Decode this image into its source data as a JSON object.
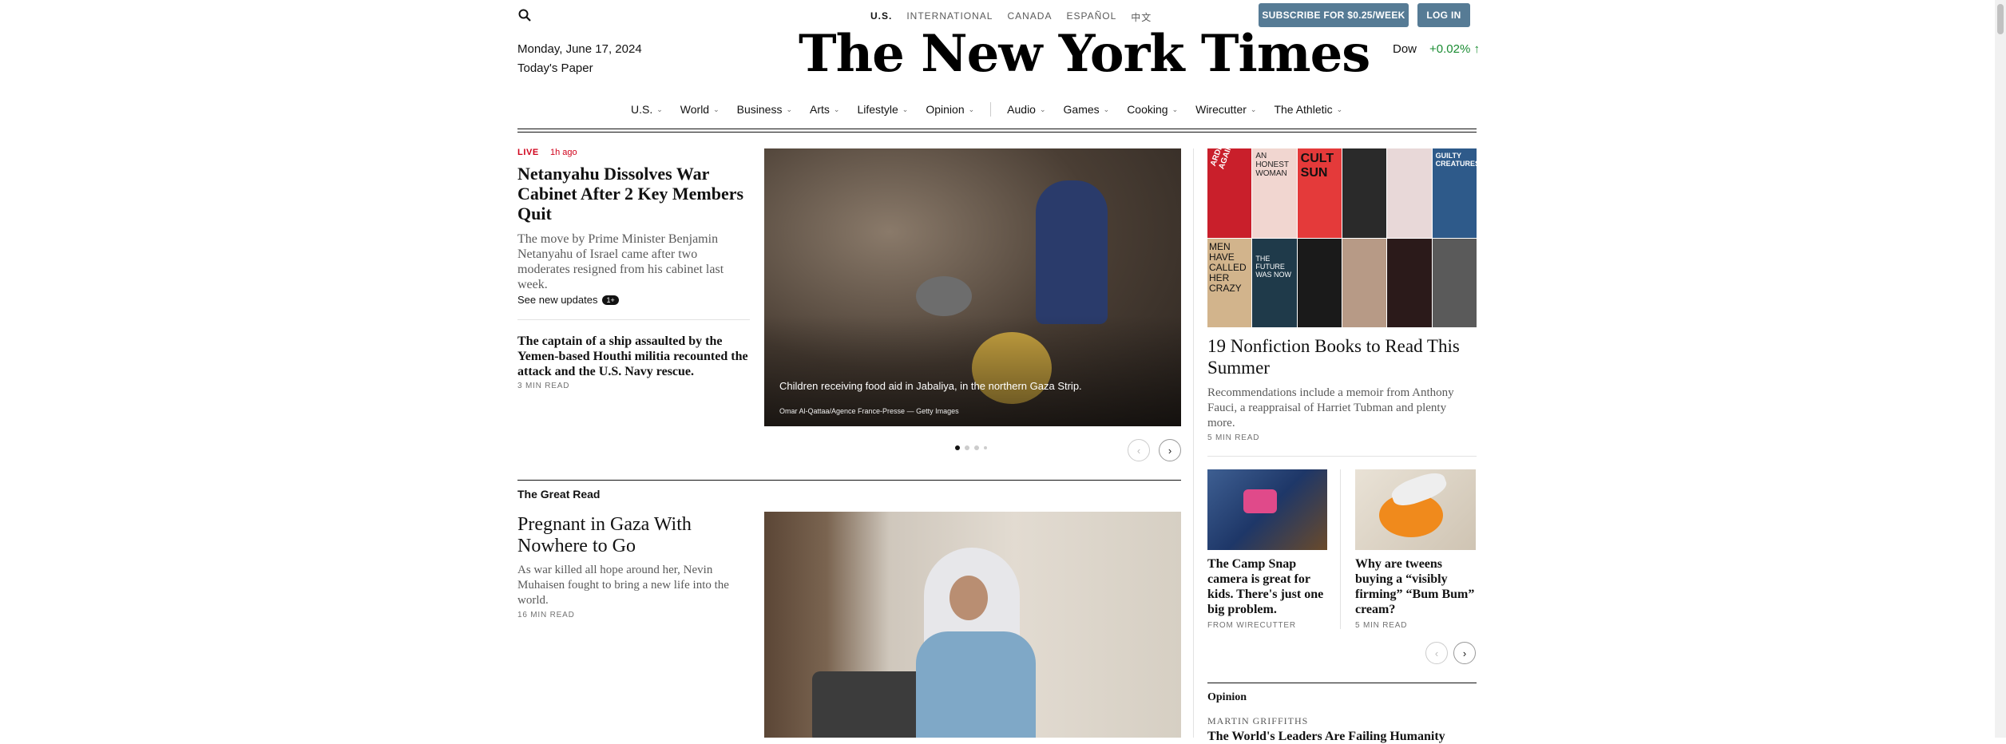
{
  "header": {
    "editions": [
      "U.S.",
      "INTERNATIONAL",
      "CANADA",
      "ESPAÑOL",
      "中文"
    ],
    "subscribe_label": "SUBSCRIBE FOR $0.25/WEEK",
    "login_label": "LOG IN",
    "date": "Monday, June 17, 2024",
    "todays_paper": "Today's Paper",
    "masthead": "The New York Times",
    "market_label": "Dow",
    "market_value": "+0.02% ↑",
    "search_icon": "search-icon"
  },
  "nav": {
    "items": [
      "U.S.",
      "World",
      "Business",
      "Arts",
      "Lifestyle",
      "Opinion",
      "Audio",
      "Games",
      "Cooking",
      "Wirecutter",
      "The Athletic"
    ]
  },
  "lead": {
    "live": "LIVE",
    "ago": "1h ago",
    "headline": "Netanyahu Dissolves War Cabinet After 2 Key Members Quit",
    "summary": "The move by Prime Minister Benjamin Netanyahu of Israel came after two moderates resigned from his cabinet last week.",
    "see_updates": "See new updates",
    "updates_badge": "1+",
    "secondary_headline": "The captain of a ship assaulted by the Yemen-based Houthi militia recounted the attack and the U.S. Navy rescue.",
    "secondary_read": "3 MIN READ",
    "photo_caption": "Children receiving food aid in Jabaliya, in the northern Gaza Strip.",
    "photo_credit": "Omar Al-Qattaa/Agence France-Presse — Getty Images"
  },
  "great_read": {
    "label": "The Great Read",
    "headline": "Pregnant in Gaza With Nowhere to Go",
    "summary": "As war killed all hope around her, Nevin Muhaisen fought to bring a new life into the world.",
    "read_time": "16 MIN READ"
  },
  "right": {
    "books_headline": "19 Nonfiction Books to Read This Summer",
    "books_summary": "Recommendations include a memoir from Anthony Fauci, a reappraisal of Harriet Tubman and plenty more.",
    "books_read": "5 MIN READ",
    "book_cover_text": [
      "ARDEN AGAIN",
      "AN HONEST WOMAN",
      "CULT SUN",
      "",
      "",
      "GUILTY CREATURES",
      "MEN HAVE CALLED HER CRAZY",
      "THE FUTURE WAS NOW",
      "",
      "",
      "",
      ""
    ],
    "card1_headline": "The Camp Snap camera is great for kids. There's just one big problem.",
    "card1_source": "FROM WIRECUTTER",
    "card2_headline": "Why are tweens buying a “visibly firming” “Bum Bum” cream?",
    "card2_read": "5 MIN READ",
    "opinion_label": "Opinion",
    "opinion_author": "MARTIN GRIFFITHS",
    "opinion_headline": "The World's Leaders Are Failing Humanity"
  },
  "colors": {
    "accent_button": "#567b95",
    "live_red": "#d0021b",
    "market_green": "#1a8c32"
  }
}
